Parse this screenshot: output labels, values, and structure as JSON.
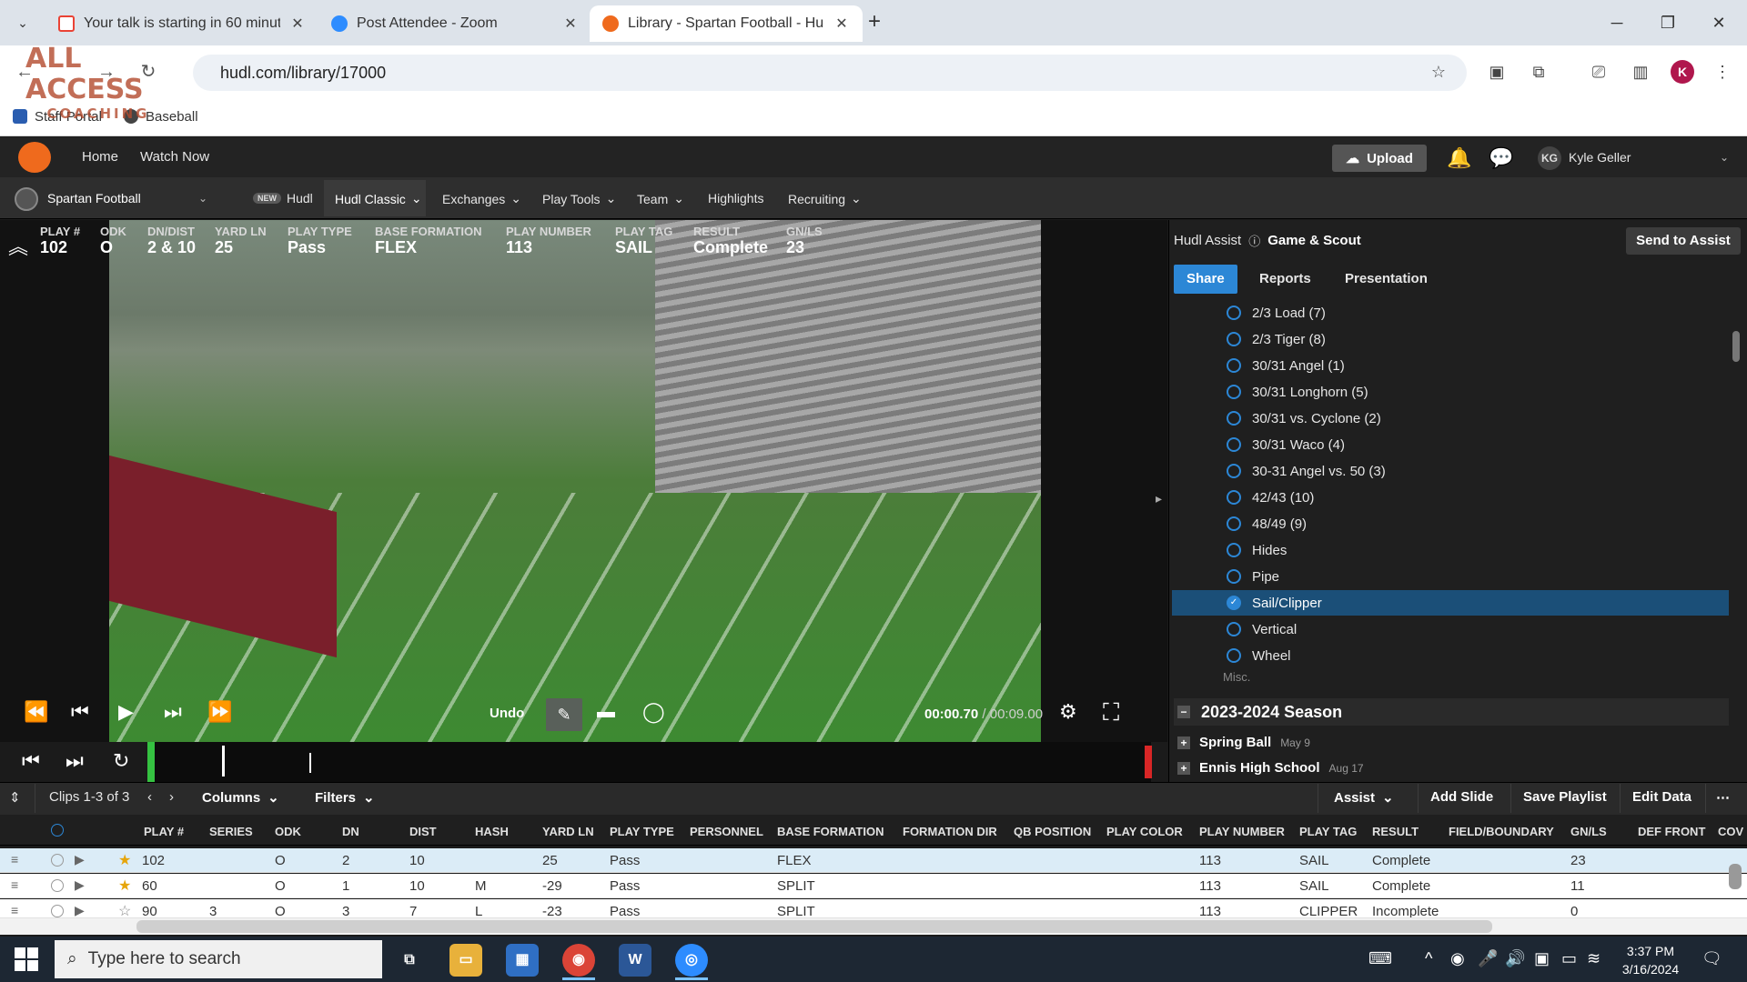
{
  "browser": {
    "tabs": [
      {
        "title": "Your talk is starting in 60 minut",
        "favicon_color": "#ea4335"
      },
      {
        "title": "Post Attendee - Zoom",
        "favicon_color": "#2d8cff"
      },
      {
        "title": "Library - Spartan Football - Huc",
        "favicon_color": "#ef6a1d"
      }
    ],
    "url": "hudl.com/library/17000",
    "profile_initial": "K",
    "bookmarks": [
      "Staff Portal",
      "Baseball"
    ]
  },
  "watermark": {
    "line1": "ALL ACCESS",
    "line2": "COACHING"
  },
  "hudl": {
    "top_nav": [
      "Home",
      "Watch Now"
    ],
    "upload_label": "Upload",
    "user_initials": "KG",
    "user_name": "Kyle Geller",
    "team": "Spartan Football",
    "new_badge": "NEW",
    "sub_nav": [
      "Hudl",
      "Hudl Classic",
      "Exchanges",
      "Play Tools",
      "Team",
      "Highlights",
      "Recruiting"
    ]
  },
  "play": {
    "stats": [
      {
        "label": "PLAY #",
        "value": "102"
      },
      {
        "label": "ODK",
        "value": "O"
      },
      {
        "label": "DN/DIST",
        "value": "2 & 10"
      },
      {
        "label": "YARD LN",
        "value": "25"
      },
      {
        "label": "PLAY TYPE",
        "value": "Pass"
      },
      {
        "label": "BASE FORMATION",
        "value": "FLEX"
      },
      {
        "label": "PLAY NUMBER",
        "value": "113"
      },
      {
        "label": "PLAY TAG",
        "value": "SAIL"
      },
      {
        "label": "RESULT",
        "value": "Complete"
      },
      {
        "label": "GN/LS",
        "value": "23"
      }
    ],
    "undo_label": "Undo",
    "time_current": "00:00.70",
    "time_total": " / 00:09.00"
  },
  "assist": {
    "label": "Hudl Assist",
    "title": "Game & Scout",
    "send_label": "Send to Assist",
    "tabs": [
      "Share",
      "Reports",
      "Presentation"
    ],
    "items": [
      "2/3 Load (7)",
      "2/3 Tiger (8)",
      "30/31 Angel (1)",
      "30/31 Longhorn (5)",
      "30/31 vs. Cyclone (2)",
      "30/31 Waco (4)",
      "30-31 Angel vs. 50 (3)",
      "42/43 (10)",
      "48/49 (9)",
      "Hides",
      "Pipe",
      "Sail/Clipper",
      "Vertical",
      "Wheel"
    ],
    "selected_index": 11,
    "misc_label": "Misc.",
    "season": "2023-2024 Season",
    "sub_seasons": [
      {
        "name": "Spring Ball",
        "date": "May 9"
      },
      {
        "name": "Ennis High School",
        "date": "Aug 17"
      }
    ]
  },
  "clip_toolbar": {
    "clips_label": "Clips 1-3 of 3",
    "columns_label": "Columns",
    "filters_label": "Filters",
    "assist_label": "Assist",
    "add_slide": "Add Slide",
    "save_playlist": "Save Playlist",
    "edit_data": "Edit Data"
  },
  "table": {
    "headers": [
      "PLAY #",
      "SERIES",
      "ODK",
      "DN",
      "DIST",
      "HASH",
      "YARD LN",
      "PLAY TYPE",
      "PERSONNEL",
      "BASE FORMATION",
      "FORMATION DIR",
      "QB POSITION",
      "PLAY COLOR",
      "PLAY NUMBER",
      "PLAY TAG",
      "RESULT",
      "FIELD/BOUNDARY",
      "GN/LS",
      "DEF FRONT",
      "COV"
    ],
    "rows": [
      {
        "play": "102",
        "series": "",
        "odk": "O",
        "dn": "2",
        "dist": "10",
        "hash": "",
        "yard": "25",
        "type": "Pass",
        "form": "FLEX",
        "pnum": "113",
        "tag": "SAIL",
        "result": "Complete",
        "gnls": "23"
      },
      {
        "play": "60",
        "series": "",
        "odk": "O",
        "dn": "1",
        "dist": "10",
        "hash": "M",
        "yard": "-29",
        "type": "Pass",
        "form": "SPLIT",
        "pnum": "113",
        "tag": "SAIL",
        "result": "Complete",
        "gnls": "11"
      },
      {
        "play": "90",
        "series": "3",
        "odk": "O",
        "dn": "3",
        "dist": "7",
        "hash": "L",
        "yard": "-23",
        "type": "Pass",
        "form": "SPLIT",
        "pnum": "113",
        "tag": "CLIPPER",
        "result": "Incomplete",
        "gnls": "0"
      }
    ]
  },
  "taskbar": {
    "search_placeholder": "Type here to search",
    "time": "3:37 PM",
    "date": "3/16/2024"
  }
}
